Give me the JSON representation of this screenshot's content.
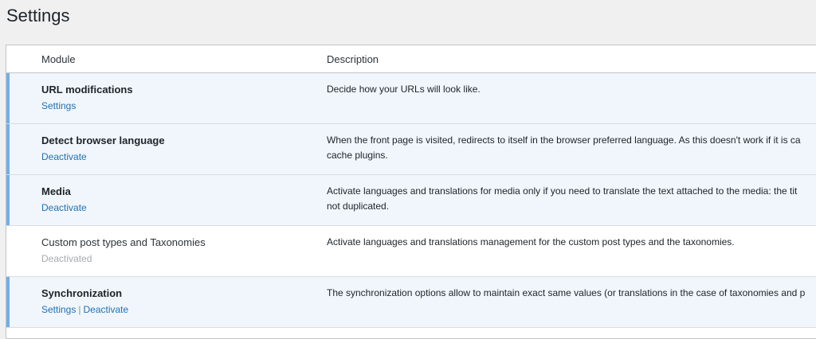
{
  "page": {
    "title": "Settings"
  },
  "table": {
    "columns": {
      "module": "Module",
      "description": "Description"
    },
    "rows": [
      {
        "name": "URL modifications",
        "active": true,
        "actions": [
          "Settings"
        ],
        "description_lines": [
          "Decide how your URLs will look like."
        ]
      },
      {
        "name": "Detect browser language",
        "active": true,
        "actions": [
          "Deactivate"
        ],
        "description_lines": [
          "When the front page is visited, redirects to itself in the browser preferred language. As this doesn't work if it is ca",
          "cache plugins."
        ]
      },
      {
        "name": "Media",
        "active": true,
        "actions": [
          "Deactivate"
        ],
        "description_lines": [
          "Activate languages and translations for media only if you need to translate the text attached to the media: the tit",
          "not duplicated."
        ]
      },
      {
        "name": "Custom post types and Taxonomies",
        "active": false,
        "status": "Deactivated",
        "description_lines": [
          "Activate languages and translations management for the custom post types and the taxonomies."
        ]
      },
      {
        "name": "Synchronization",
        "active": true,
        "actions": [
          "Settings",
          "Deactivate"
        ],
        "action_separator": "|",
        "description_lines": [
          "The synchronization options allow to maintain exact same values (or translations in the case of taxonomies and p"
        ]
      }
    ]
  },
  "colors": {
    "active_row_bg": "#f0f6fc",
    "active_row_accent": "#72aee6",
    "link": "#2271b1",
    "disabled": "#a7aaad"
  }
}
